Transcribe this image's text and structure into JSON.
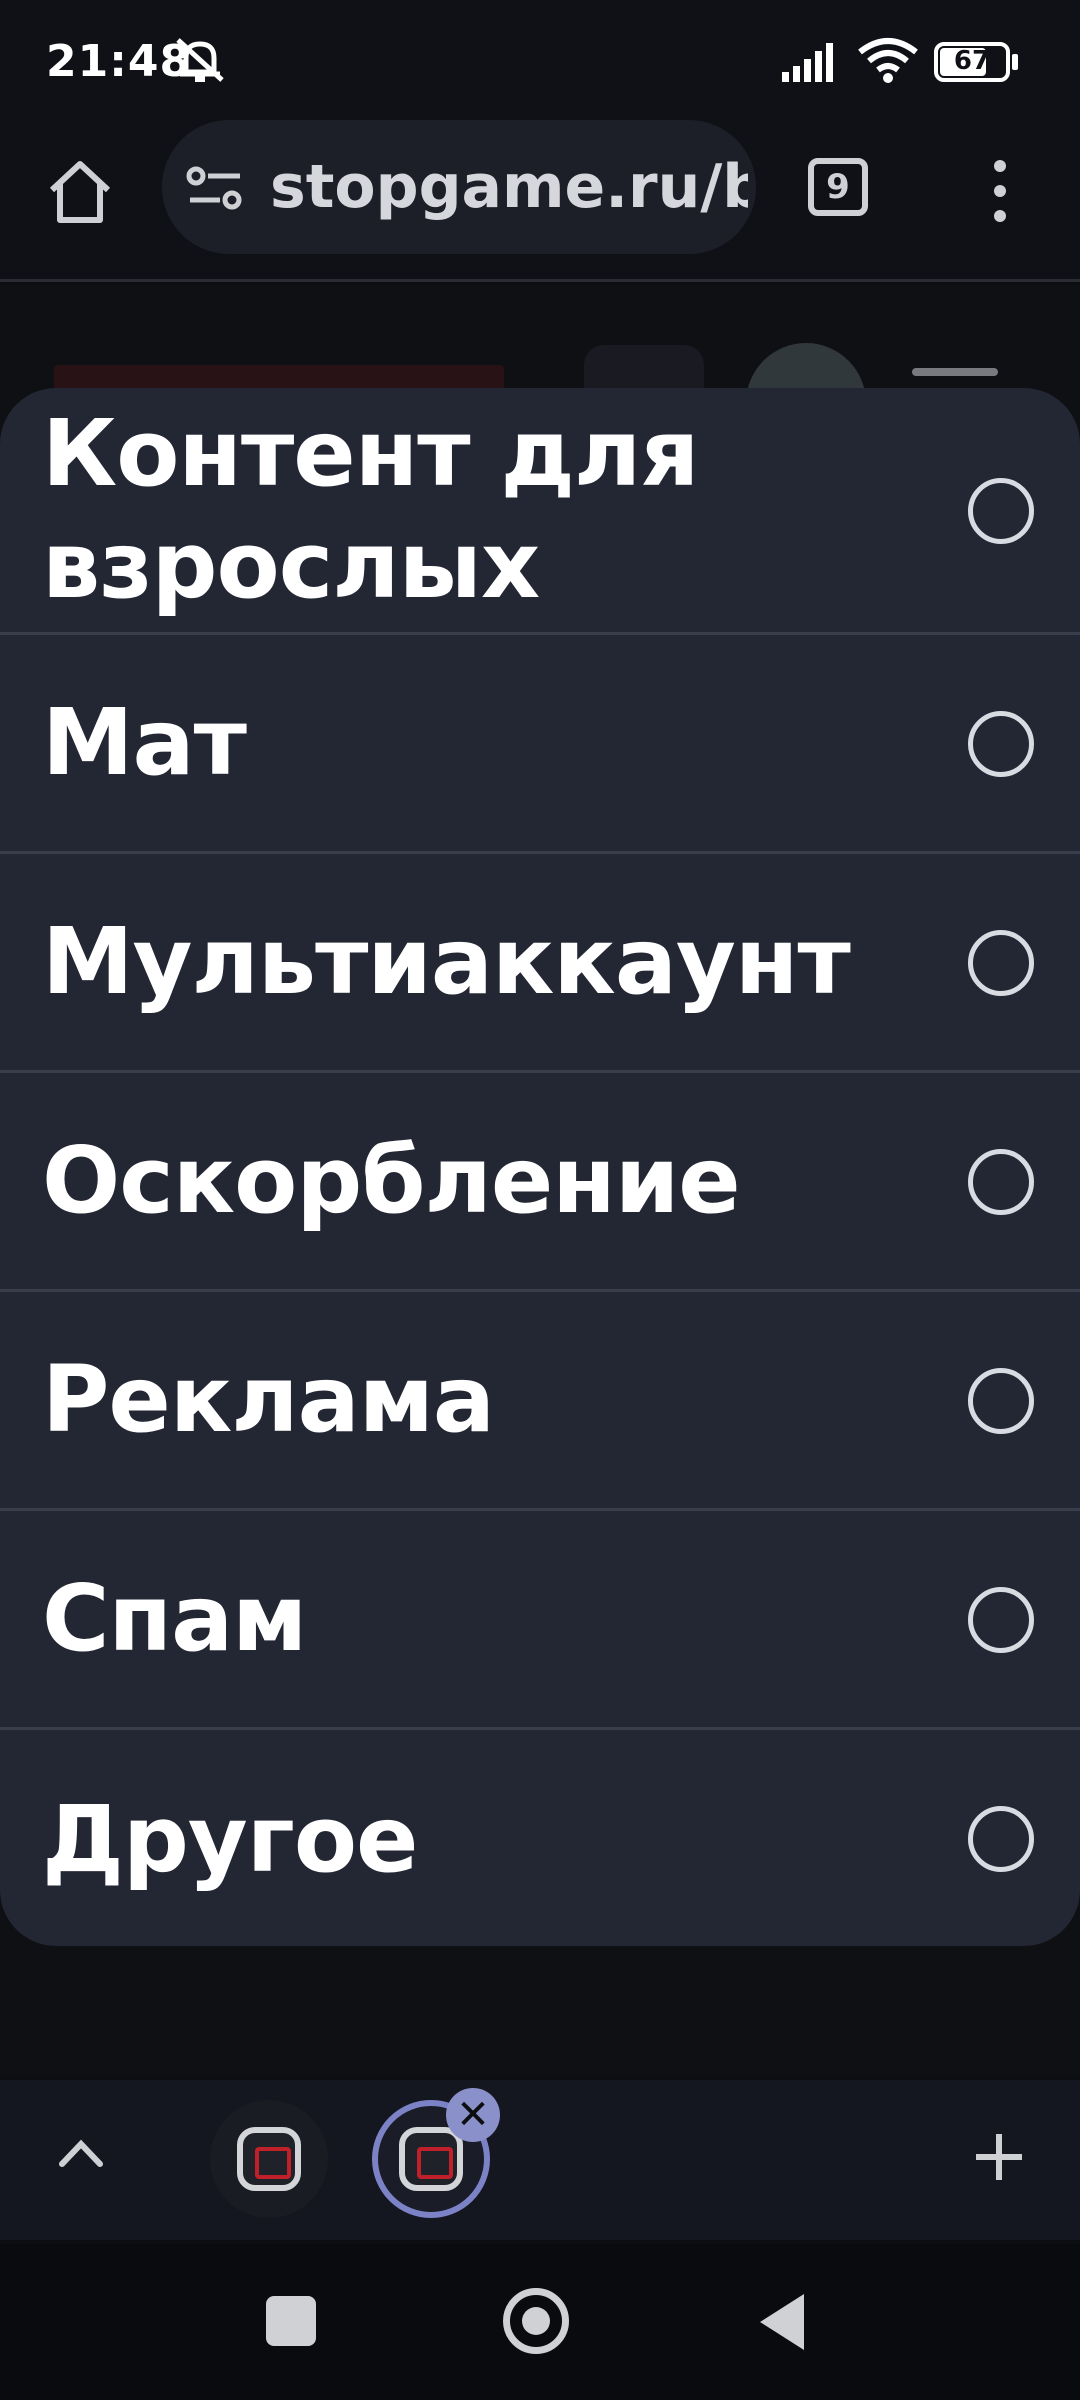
{
  "status_bar": {
    "time": "21:48",
    "battery": "67",
    "icons": [
      "notifications-off-icon",
      "signal-icon",
      "wifi-icon",
      "battery-icon"
    ]
  },
  "toolbar": {
    "url": "stopgame.ru/b",
    "tab_count": "9",
    "icons": [
      "home-icon",
      "site-settings-icon",
      "more-vert-icon"
    ]
  },
  "dialog": {
    "options": [
      {
        "label": "Контент для взрослых",
        "selected": false
      },
      {
        "label": "Мат",
        "selected": false
      },
      {
        "label": "Мультиаккаунт",
        "selected": false
      },
      {
        "label": "Оскорбление",
        "selected": false
      },
      {
        "label": "Реклама",
        "selected": false
      },
      {
        "label": "Спам",
        "selected": false
      },
      {
        "label": "Другое",
        "selected": false
      }
    ]
  },
  "tab_strip": {
    "close_glyph": "✕",
    "icons": [
      "chevron-up-icon",
      "stopgame-tab-icon",
      "plus-icon"
    ]
  },
  "colors": {
    "sheet_bg": "#232633",
    "divider": "#3a3e4c",
    "active_tab_ring": "#7c82c6"
  }
}
